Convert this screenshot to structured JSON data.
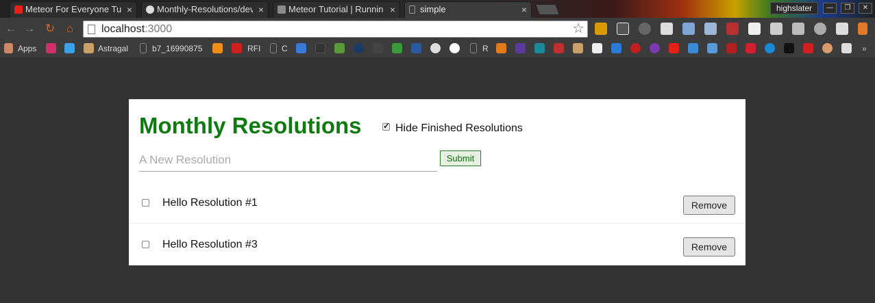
{
  "browser": {
    "tabs": [
      {
        "title": "Meteor For Everyone Tut",
        "icon": "youtube-icon",
        "active": false
      },
      {
        "title": "Monthly-Resolutions/dev",
        "icon": "github-icon",
        "active": false
      },
      {
        "title": "Meteor Tutorial | Runnin",
        "icon": "meteor-icon",
        "active": false
      },
      {
        "title": "simple",
        "icon": "page-icon",
        "active": true
      }
    ],
    "tab_close_glyph": "×",
    "user_name": "highslater",
    "address": {
      "host": "localhost",
      "port": ":3000"
    },
    "bookmarks": [
      {
        "label": "Apps",
        "icon": "apps-grid-icon"
      },
      {
        "label": "",
        "icon": "l-icon"
      },
      {
        "label": "",
        "icon": "twitter-icon"
      },
      {
        "label": "Astragal",
        "icon": "astragal-icon"
      },
      {
        "label": "b7_16990875",
        "icon": "page-icon"
      },
      {
        "label": "",
        "icon": "chart-icon"
      },
      {
        "label": "RFI",
        "icon": "rfi-icon"
      },
      {
        "label": "C",
        "icon": "page-icon"
      },
      {
        "label": "R",
        "icon": "page-icon"
      }
    ]
  },
  "colors": {
    "title": "#0f7a0f",
    "background": "#333333",
    "card": "#ffffff"
  },
  "app": {
    "title": "Monthly Resolutions",
    "hide_finished_label": "Hide Finished Resolutions",
    "hide_finished_checked": true,
    "new_resolution_placeholder": "A New Resolution",
    "submit_label": "Submit",
    "resolutions": [
      {
        "text": "Hello Resolution #1",
        "checked": false,
        "remove_label": "Remove"
      },
      {
        "text": "Hello Resolution #3",
        "checked": false,
        "remove_label": "Remove"
      }
    ]
  }
}
